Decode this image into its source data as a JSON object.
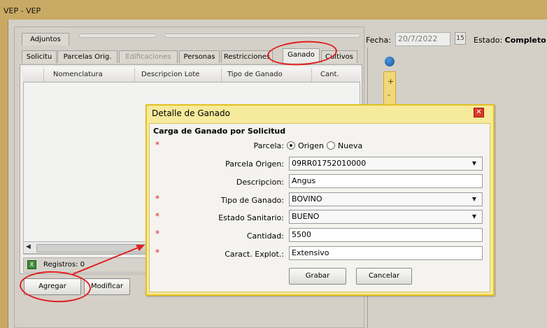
{
  "window": {
    "title": "VEP  -  VEP"
  },
  "tabs_top": {
    "adjuntos": "Adjuntos"
  },
  "tabs": [
    {
      "label": "Solicitu"
    },
    {
      "label": "Parcelas Orig."
    },
    {
      "label": "Edificaciones"
    },
    {
      "label": "Personas"
    },
    {
      "label": "Restricciones"
    },
    {
      "label": "Ganado"
    },
    {
      "label": "Cultivos"
    }
  ],
  "grid": {
    "columns": [
      "Nomenclatura",
      "Descripcion Lote",
      "Tipo de Ganado",
      "Cant."
    ],
    "footer": "Registros: 0"
  },
  "buttons": {
    "agregar": "Agregar",
    "modificar": "Modificar"
  },
  "header": {
    "fecha_label": "Fecha:",
    "fecha_value": "20/7/2022",
    "calendar_text": "15",
    "estado_label": "Estado:",
    "estado_value": "Completo"
  },
  "map_controls": {
    "zoom_in": "+",
    "zoom_out": "-"
  },
  "dialog": {
    "title": "Detalle de Ganado",
    "section": "Carga de Ganado por Solicitud",
    "required_mark": "*",
    "fields": {
      "parcela_label": "Parcela:",
      "parcela_option1": "Origen",
      "parcela_option2": "Nueva",
      "parcela_origen_label": "Parcela Origen:",
      "parcela_origen_value": "09RR01752010000",
      "descripcion_label": "Descripcion:",
      "descripcion_value": "Angus",
      "tipo_label": "Tipo de Ganado:",
      "tipo_value": "BOVINO",
      "estado_label": "Estado Sanitario:",
      "estado_value": "BUENO",
      "cantidad_label": "Cantidad:",
      "cantidad_value": "5500",
      "caract_label": "Caract. Explot.:",
      "caract_value": "Extensivo"
    },
    "buttons": {
      "grabar": "Grabar",
      "cancelar": "Cancelar"
    }
  },
  "colors": {
    "accent_title": "#c8aa64",
    "dialog_border": "#e3c21e",
    "annotation": "#e02020"
  }
}
